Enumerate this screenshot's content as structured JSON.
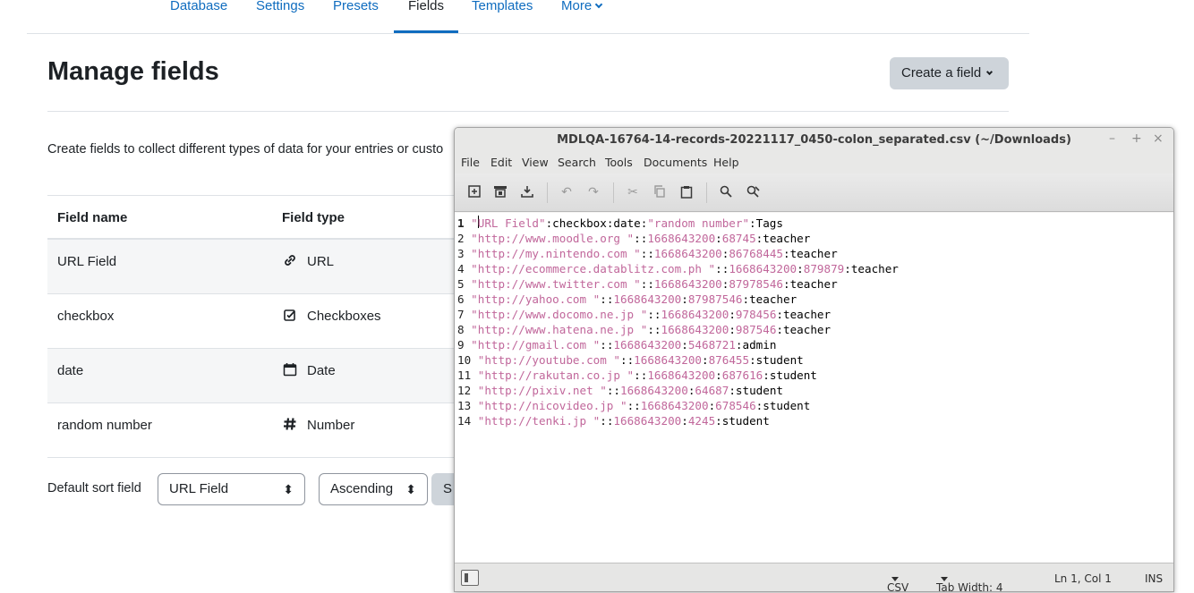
{
  "secondary_nav": {
    "tabs": [
      {
        "label": "Database",
        "active": false
      },
      {
        "label": "Settings",
        "active": false
      },
      {
        "label": "Presets",
        "active": false
      },
      {
        "label": "Fields",
        "active": true
      },
      {
        "label": "Templates",
        "active": false
      },
      {
        "label": "More",
        "active": false,
        "dropdown": true
      }
    ]
  },
  "page": {
    "title": "Manage fields",
    "create_button": "Create a field",
    "intro": "Create fields to collect different types of data for your entries or custo"
  },
  "fields_table": {
    "headers": [
      "Field name",
      "Field type"
    ],
    "rows": [
      {
        "name": "URL Field",
        "type": "URL",
        "icon": "link-icon"
      },
      {
        "name": "checkbox",
        "type": "Checkboxes",
        "icon": "checkbox-icon"
      },
      {
        "name": "date",
        "type": "Date",
        "icon": "calendar-icon"
      },
      {
        "name": "random number",
        "type": "Number",
        "icon": "hash-icon"
      }
    ]
  },
  "sort": {
    "label": "Default sort field",
    "field_value": "URL Field",
    "direction_value": "Ascending",
    "save_label": "S"
  },
  "editor": {
    "title": "MDLQA-16764-14-records-20221117_0450-colon_separated.csv (~/Downloads)",
    "window_buttons": [
      "–",
      "+",
      "×"
    ],
    "menu": [
      "File",
      "Edit",
      "View",
      "Search",
      "Tools",
      "Documents",
      "Help"
    ],
    "toolbar_icons": [
      "new-document-icon",
      "copy-document-icon",
      "save-icon",
      "undo-icon",
      "redo-icon",
      "cut-icon",
      "copy-icon",
      "paste-icon",
      "find-icon",
      "find-replace-icon"
    ],
    "lines": [
      "\"URL Field\":checkbox:date:\"random number\":Tags",
      "\"http://www.moodle.org \"::1668643200:68745:teacher",
      "\"http://my.nintendo.com \"::1668643200:86768445:teacher",
      "\"http://ecommerce.datablitz.com.ph \"::1668643200:879879:teacher",
      "\"http://www.twitter.com \"::1668643200:87978546:teacher",
      "\"http://yahoo.com \"::1668643200:87987546:teacher",
      "\"http://www.docomo.ne.jp \"::1668643200:978456:teacher",
      "\"http://www.hatena.ne.jp \"::1668643200:987546:teacher",
      "\"http://gmail.com \"::1668643200:5468721:admin",
      "\"http://youtube.com \"::1668643200:876455:student",
      "\"http://rakutan.co.jp \"::1668643200:687616:student",
      "\"http://pixiv.net \"::1668643200:64687:student",
      "\"http://nicovideo.jp \"::1668643200:678546:student",
      "\"http://tenki.jp \"::1668643200:4245:student"
    ],
    "status": {
      "language": "CSV",
      "tab_width": "Tab Width: 4",
      "position": "Ln 1, Col 1",
      "mode": "INS"
    }
  }
}
